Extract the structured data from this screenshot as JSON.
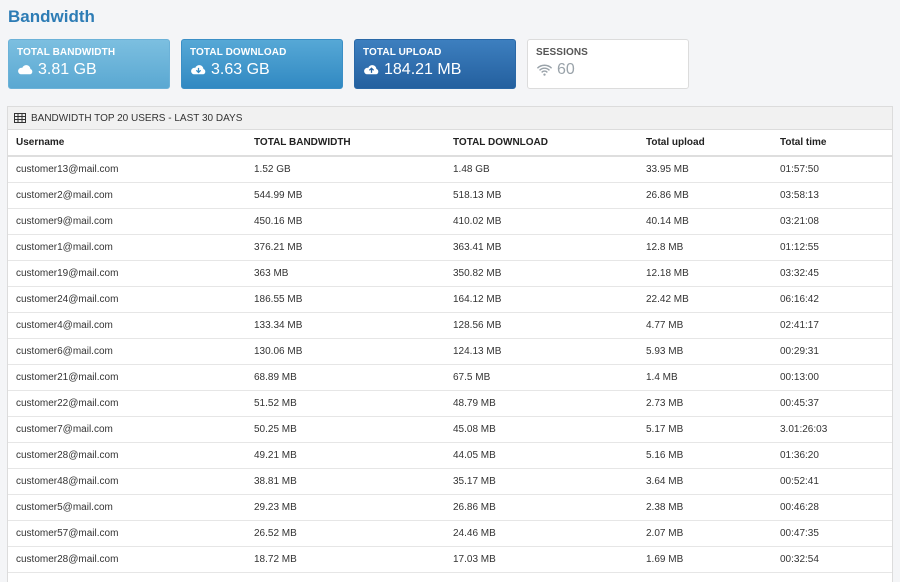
{
  "page": {
    "title": "Bandwidth"
  },
  "cards": {
    "bandwidth": {
      "label": "TOTAL BANDWIDTH",
      "value": "3.81 GB",
      "icon": "cloud-icon"
    },
    "download": {
      "label": "TOTAL DOWNLOAD",
      "value": "3.63 GB",
      "icon": "cloud-download-icon"
    },
    "upload": {
      "label": "TOTAL UPLOAD",
      "value": "184.21 MB",
      "icon": "cloud-upload-icon"
    },
    "sessions": {
      "label": "SESSIONS",
      "value": "60",
      "icon": "wifi-icon"
    }
  },
  "panel": {
    "title": "BANDWIDTH TOP 20 USERS - LAST 30 DAYS",
    "columns": [
      "Username",
      "TOTAL BANDWIDTH",
      "TOTAL DOWNLOAD",
      "Total upload",
      "Total time"
    ],
    "rows": [
      [
        "customer13@mail.com",
        "1.52 GB",
        "1.48 GB",
        "33.95 MB",
        "01:57:50"
      ],
      [
        "customer2@mail.com",
        "544.99 MB",
        "518.13 MB",
        "26.86 MB",
        "03:58:13"
      ],
      [
        "customer9@mail.com",
        "450.16 MB",
        "410.02 MB",
        "40.14 MB",
        "03:21:08"
      ],
      [
        "customer1@mail.com",
        "376.21 MB",
        "363.41 MB",
        "12.8 MB",
        "01:12:55"
      ],
      [
        "customer19@mail.com",
        "363 MB",
        "350.82 MB",
        "12.18 MB",
        "03:32:45"
      ],
      [
        "customer24@mail.com",
        "186.55 MB",
        "164.12 MB",
        "22.42 MB",
        "06:16:42"
      ],
      [
        "customer4@mail.com",
        "133.34 MB",
        "128.56 MB",
        "4.77 MB",
        "02:41:17"
      ],
      [
        "customer6@mail.com",
        "130.06 MB",
        "124.13 MB",
        "5.93 MB",
        "00:29:31"
      ],
      [
        "customer21@mail.com",
        "68.89 MB",
        "67.5 MB",
        "1.4 MB",
        "00:13:00"
      ],
      [
        "customer22@mail.com",
        "51.52 MB",
        "48.79 MB",
        "2.73 MB",
        "00:45:37"
      ],
      [
        "customer7@mail.com",
        "50.25 MB",
        "45.08 MB",
        "5.17 MB",
        "3.01:26:03"
      ],
      [
        "customer28@mail.com",
        "49.21 MB",
        "44.05 MB",
        "5.16 MB",
        "01:36:20"
      ],
      [
        "customer48@mail.com",
        "38.81 MB",
        "35.17 MB",
        "3.64 MB",
        "00:52:41"
      ],
      [
        "customer5@mail.com",
        "29.23 MB",
        "26.86 MB",
        "2.38 MB",
        "00:46:28"
      ],
      [
        "customer57@mail.com",
        "26.52 MB",
        "24.46 MB",
        "2.07 MB",
        "00:47:35"
      ],
      [
        "customer28@mail.com",
        "18.72 MB",
        "17.03 MB",
        "1.69 MB",
        "00:32:54"
      ]
    ]
  }
}
